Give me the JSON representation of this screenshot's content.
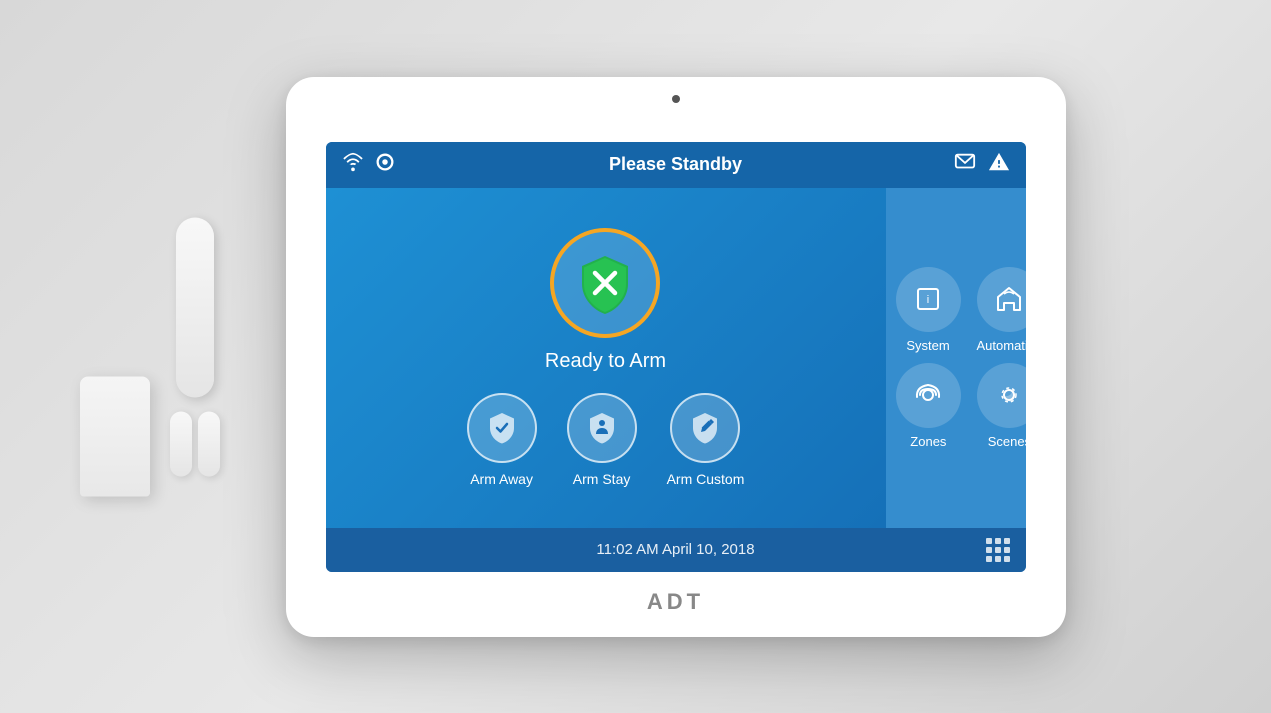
{
  "statusBar": {
    "title": "Please Standby"
  },
  "main": {
    "readyLabel": "Ready to Arm",
    "actions": [
      {
        "id": "arm-away",
        "label": "Arm Away"
      },
      {
        "id": "arm-stay",
        "label": "Arm Stay"
      },
      {
        "id": "arm-custom",
        "label": "Arm Custom"
      }
    ],
    "gridItems": [
      {
        "id": "system",
        "label": "System",
        "row": 0
      },
      {
        "id": "automation",
        "label": "Automation",
        "row": 0
      },
      {
        "id": "zones",
        "label": "Zones",
        "row": 1
      },
      {
        "id": "scenes",
        "label": "Scenes",
        "row": 1
      }
    ]
  },
  "footer": {
    "timestamp": "11:02 AM April 10, 2018"
  },
  "brand": {
    "label": "ADT"
  }
}
